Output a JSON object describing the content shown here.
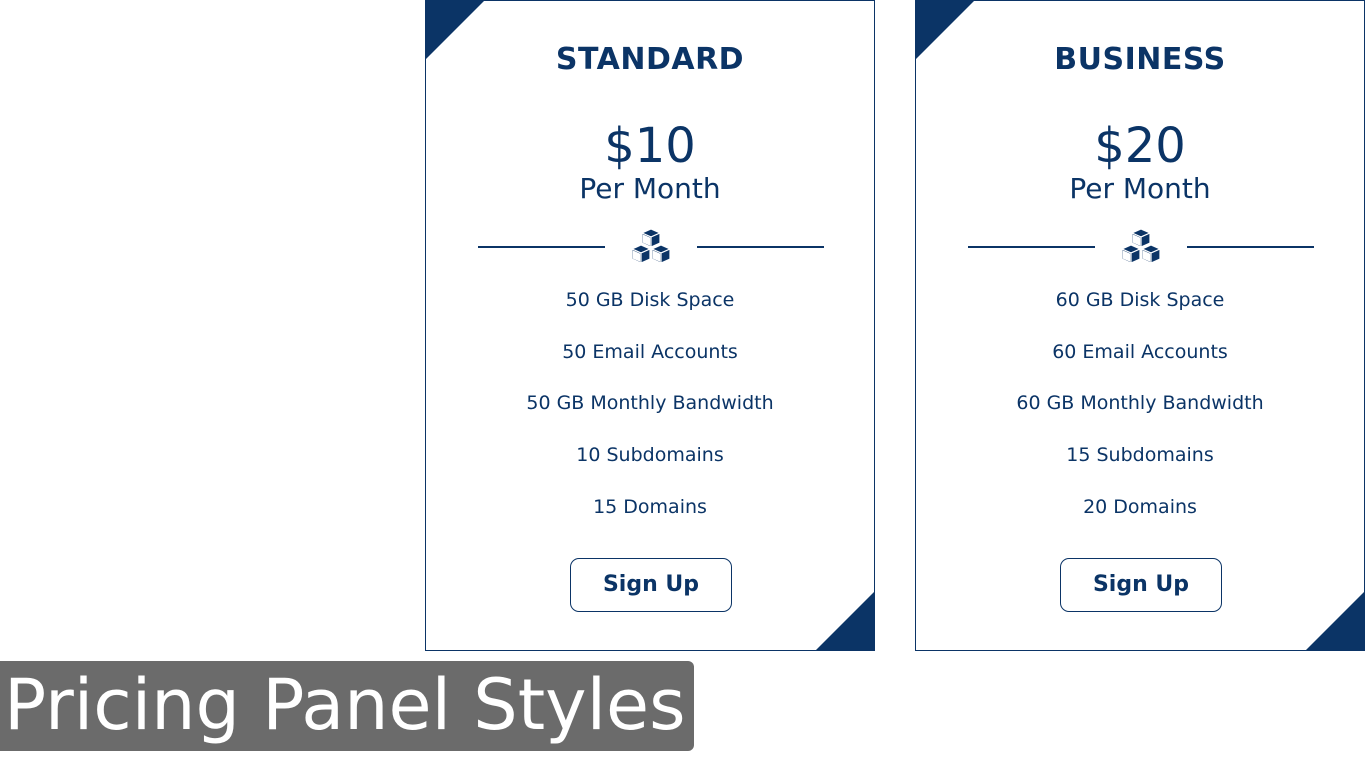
{
  "caption": "Pricing Panel Styles",
  "colors": {
    "brand": "#0b3466",
    "caption_bg": "#6b6b6b"
  },
  "plans": [
    {
      "name": "STANDARD",
      "price": "$10",
      "period": "Per Month",
      "icon": "cubes-icon",
      "features": [
        "50 GB Disk Space",
        "50 Email Accounts",
        "50 GB Monthly Bandwidth",
        "10 Subdomains",
        "15 Domains"
      ],
      "button_label": "Sign Up"
    },
    {
      "name": "BUSINESS",
      "price": "$20",
      "period": "Per Month",
      "icon": "cubes-icon",
      "features": [
        "60 GB Disk Space",
        "60 Email Accounts",
        "60 GB Monthly Bandwidth",
        "15 Subdomains",
        "20 Domains"
      ],
      "button_label": "Sign Up"
    }
  ]
}
